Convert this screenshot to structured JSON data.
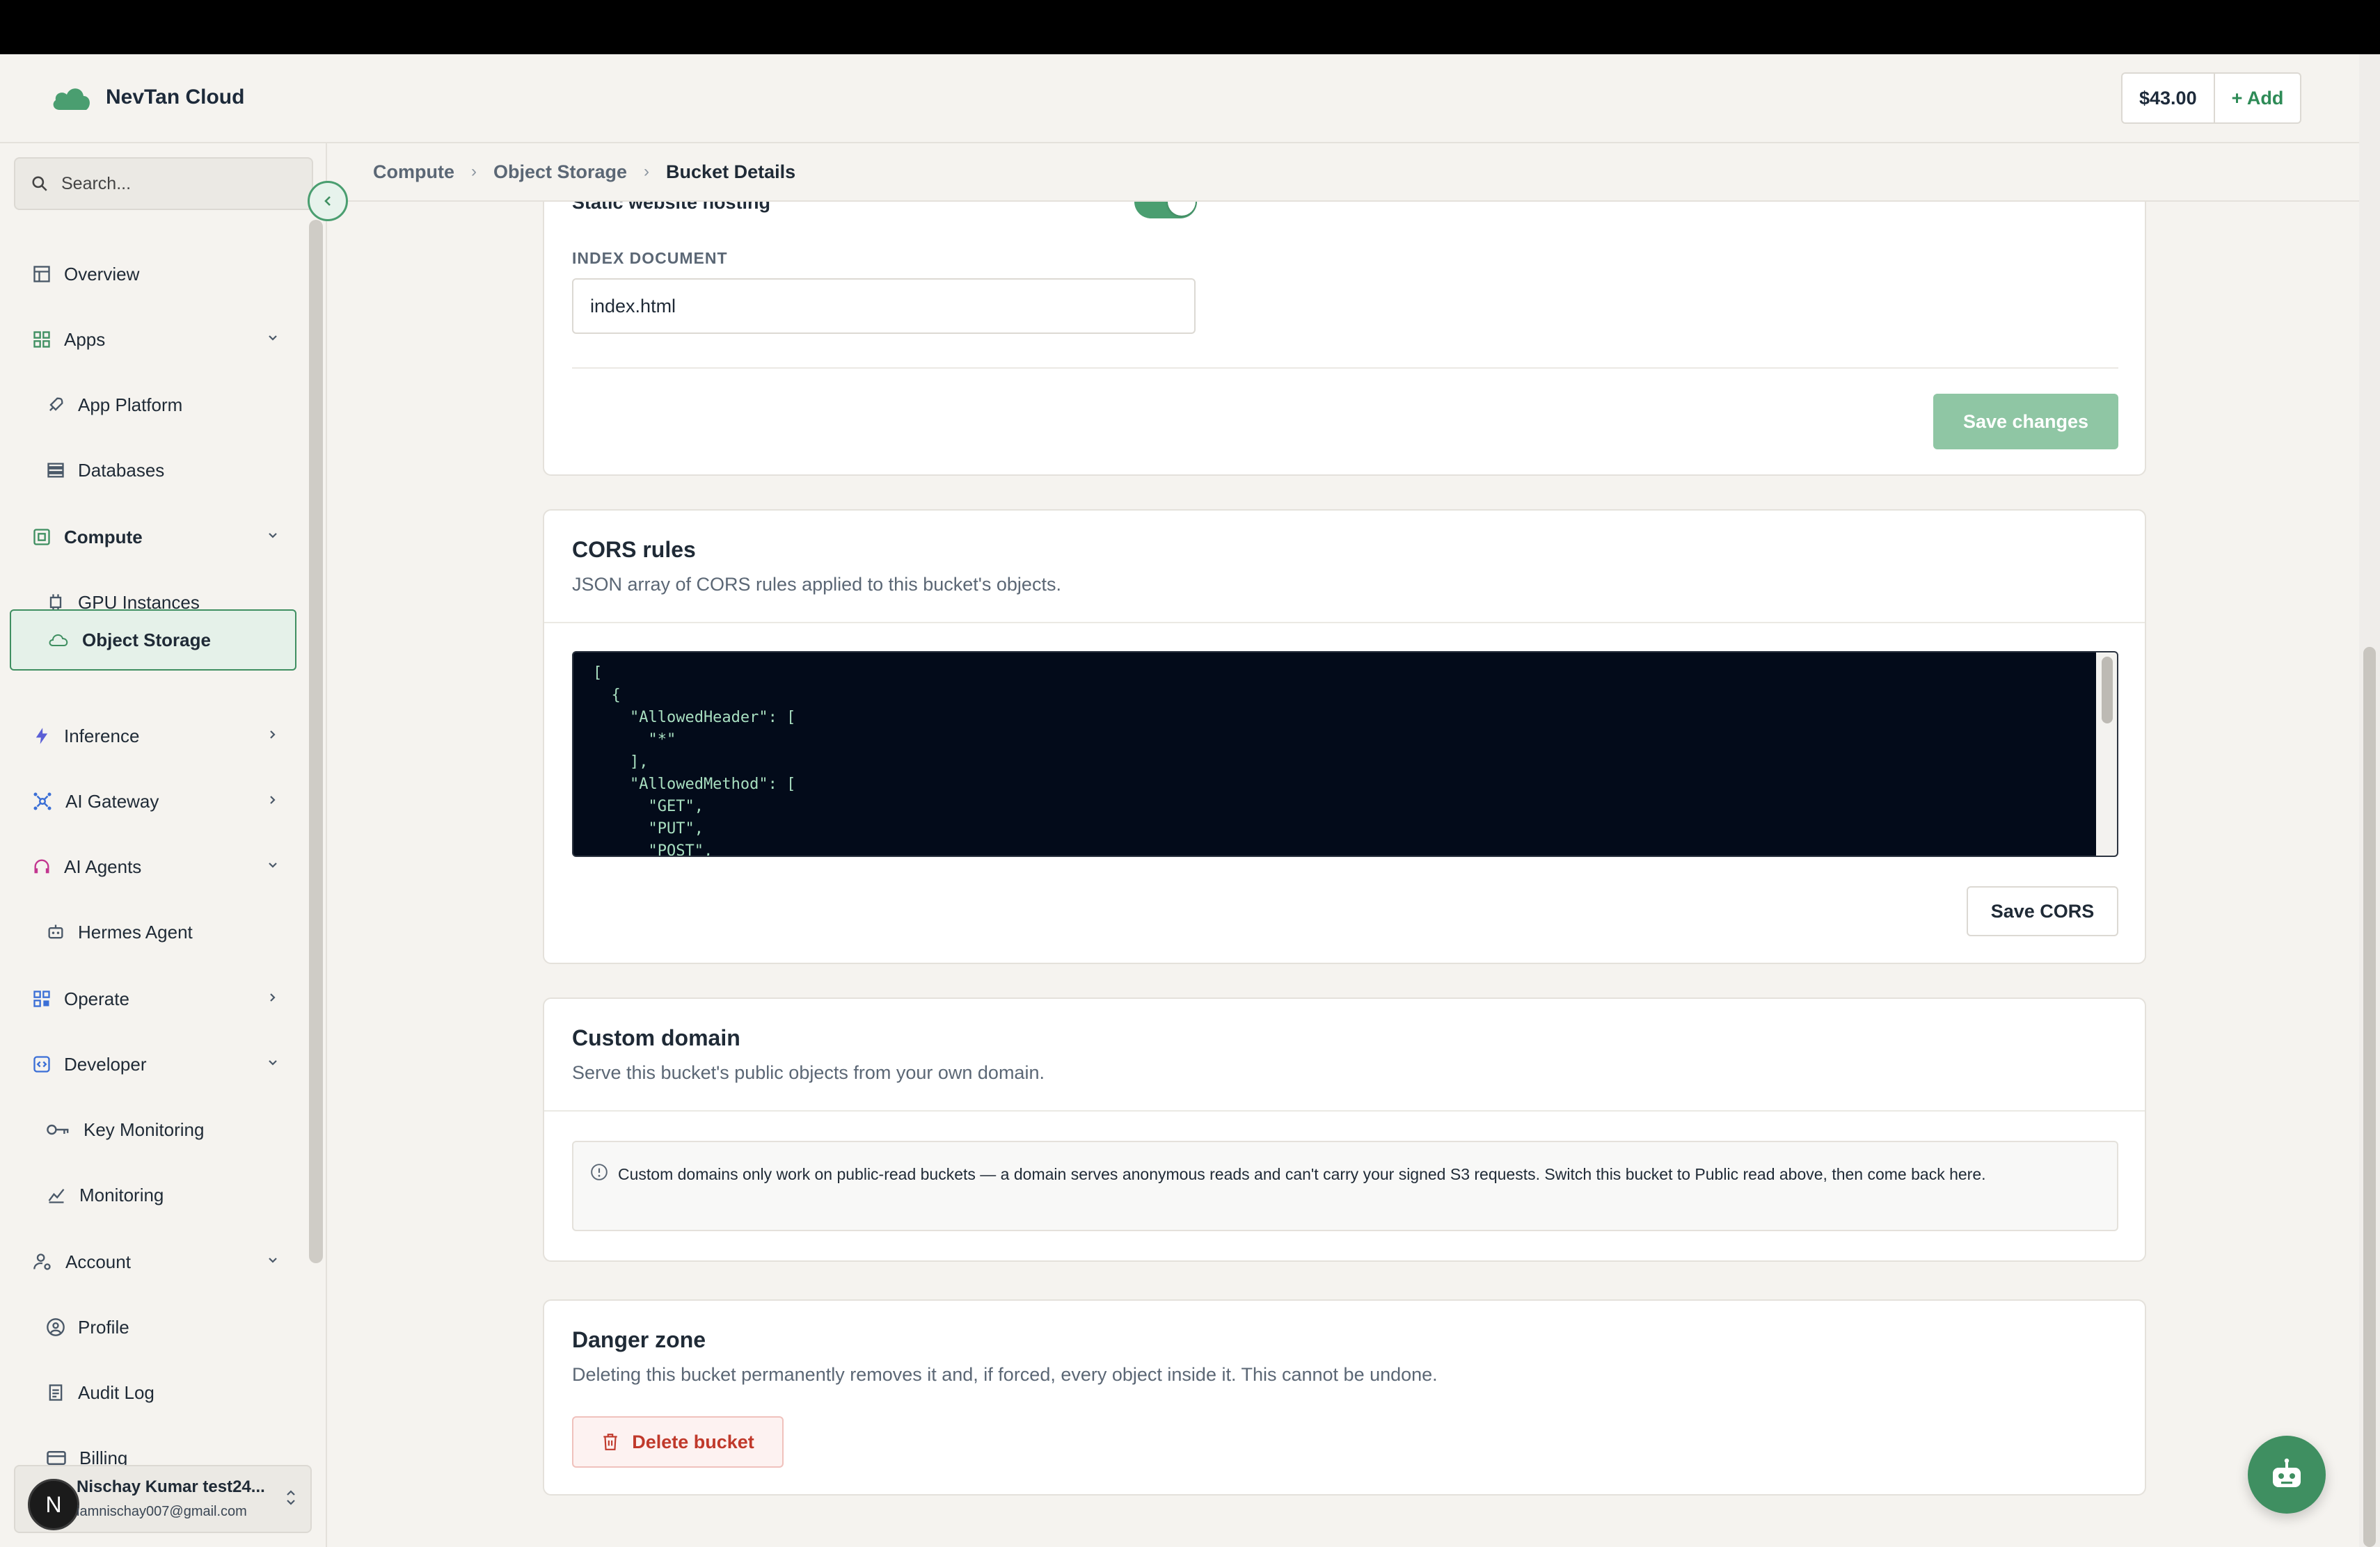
{
  "header": {
    "brand_name": "NevTan Cloud",
    "credit_amount": "$43.00",
    "add_label": "+ Add"
  },
  "sidebar": {
    "search_placeholder": "Search...",
    "items": [
      {
        "label": "Overview",
        "icon": "layout-icon"
      },
      {
        "label": "Apps",
        "icon": "apps-icon"
      },
      {
        "label": "App Platform",
        "icon": "rocket-icon"
      },
      {
        "label": "Databases",
        "icon": "database-icon"
      },
      {
        "label": "Compute",
        "icon": "compute-icon"
      },
      {
        "label": "GPU Instances",
        "icon": "chip-icon"
      },
      {
        "label": "Object Storage",
        "icon": "cloud-icon"
      },
      {
        "label": "Inference",
        "icon": "bolt-icon"
      },
      {
        "label": "AI Gateway",
        "icon": "network-icon"
      },
      {
        "label": "AI Agents",
        "icon": "headset-icon"
      },
      {
        "label": "Hermes Agent",
        "icon": "robot-icon"
      },
      {
        "label": "Operate",
        "icon": "grid-icon"
      },
      {
        "label": "Developer",
        "icon": "code-icon"
      },
      {
        "label": "Key Monitoring",
        "icon": "key-icon"
      },
      {
        "label": "Monitoring",
        "icon": "chart-icon"
      },
      {
        "label": "Account",
        "icon": "user-cog-icon"
      },
      {
        "label": "Profile",
        "icon": "user-circle-icon"
      },
      {
        "label": "Audit Log",
        "icon": "clipboard-icon"
      },
      {
        "label": "Billing",
        "icon": "card-icon"
      }
    ],
    "user": {
      "initial": "N",
      "name": "Nischay Kumar test24...",
      "email": "iamnischay007@gmail.com"
    }
  },
  "breadcrumb": [
    "Compute",
    "Object Storage",
    "Bucket Details"
  ],
  "static_hosting": {
    "label": "Static website hosting",
    "enabled": true,
    "index_label": "INDEX DOCUMENT",
    "index_value": "index.html",
    "save_label": "Save changes"
  },
  "cors": {
    "title": "CORS rules",
    "subtitle": "JSON array of CORS rules applied to this bucket's objects.",
    "code": "[\n  {\n    \"AllowedHeader\": [\n      \"*\"\n    ],\n    \"AllowedMethod\": [\n      \"GET\",\n      \"PUT\",\n      \"POST\",",
    "save_label": "Save CORS"
  },
  "custom_domain": {
    "title": "Custom domain",
    "subtitle": "Serve this bucket's public objects from your own domain.",
    "notice": "Custom domains only work on public-read buckets — a domain serves anonymous reads and can't carry your signed S3 requests. Switch this bucket to Public read above, then come back here."
  },
  "danger_zone": {
    "title": "Danger zone",
    "subtitle": "Deleting this bucket permanently removes it and, if forced, every object inside it. This cannot be undone.",
    "delete_label": "Delete bucket"
  },
  "colors": {
    "accent": "#3f8f61",
    "danger": "#c0392b",
    "code_bg": "#030b1a"
  }
}
